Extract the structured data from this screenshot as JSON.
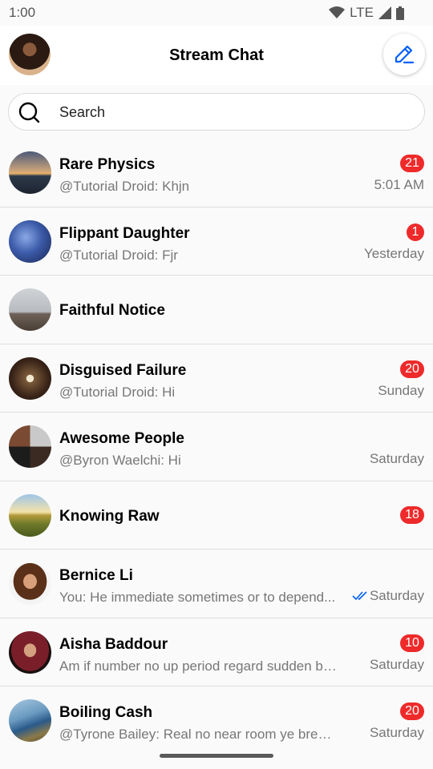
{
  "status_bar": {
    "time": "1:00",
    "network": "LTE"
  },
  "header": {
    "title": "Stream Chat"
  },
  "search": {
    "placeholder": "Search"
  },
  "channels": [
    {
      "name": "Rare Physics",
      "preview": "@Tutorial Droid: Khjn",
      "time": "5:01 AM",
      "unread": "21"
    },
    {
      "name": "Flippant Daughter",
      "preview": "@Tutorial Droid: Fjr",
      "time": "Yesterday",
      "unread": "1"
    },
    {
      "name": "Faithful Notice",
      "preview": "",
      "time": "",
      "unread": ""
    },
    {
      "name": "Disguised Failure",
      "preview": "@Tutorial Droid: Hi",
      "time": "Sunday",
      "unread": "20"
    },
    {
      "name": "Awesome People",
      "preview": "@Byron Waelchi: Hi",
      "time": "Saturday",
      "unread": ""
    },
    {
      "name": "Knowing Raw",
      "preview": "",
      "time": "",
      "unread": "18"
    },
    {
      "name": "Bernice Li",
      "preview": "You: He immediate sometimes or to depend...",
      "time": "Saturday",
      "unread": "",
      "read_receipt": true
    },
    {
      "name": "Aisha Baddour",
      "preview": "Am if number no up period regard sudden be...",
      "time": "Saturday",
      "unread": "10"
    },
    {
      "name": "Boiling Cash",
      "preview": "@Tyrone Bailey: Real no near room ye bred s...",
      "time": "Saturday",
      "unread": "20"
    }
  ],
  "colors": {
    "accent": "#005fff",
    "badge": "#ee2a2a",
    "secondary_text": "#777777"
  }
}
